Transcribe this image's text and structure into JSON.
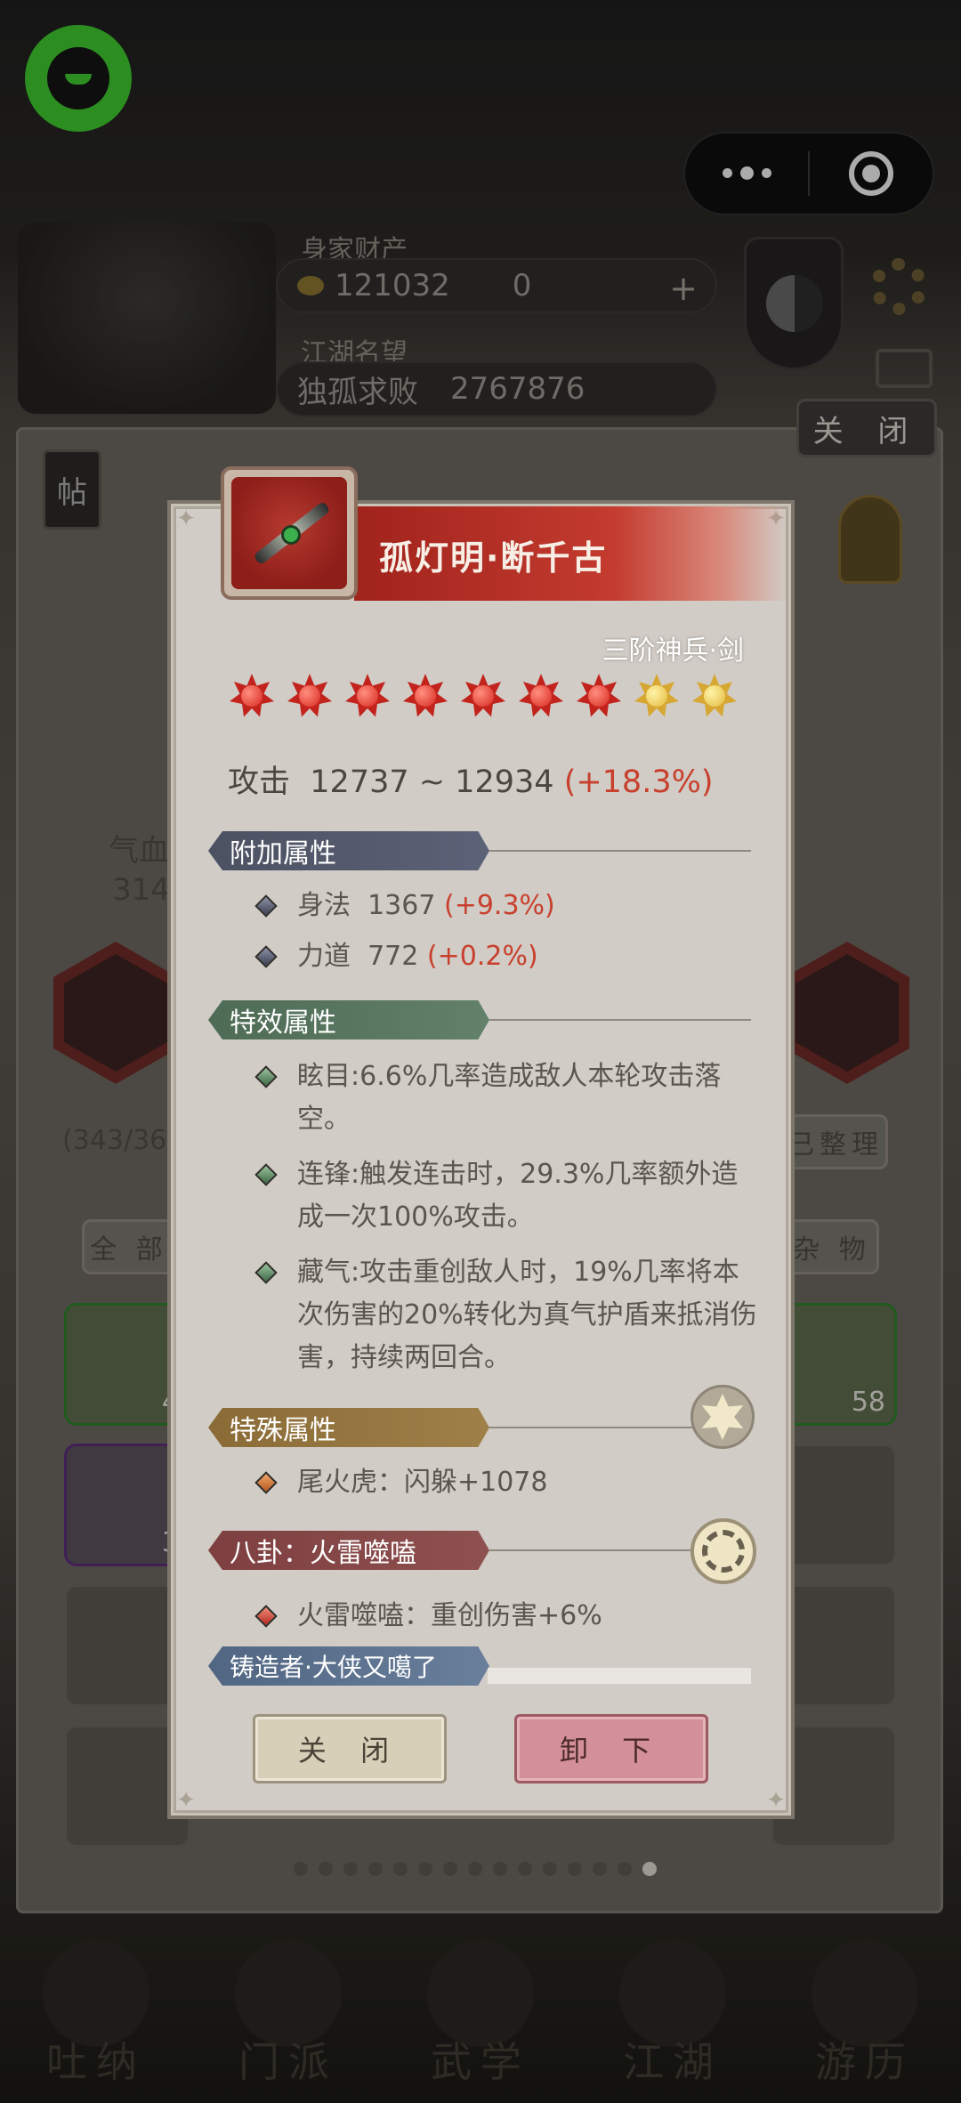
{
  "background": {
    "assets_label": "身家财产",
    "coins": "121032",
    "tickets": "0",
    "fame_label": "江湖名望",
    "fame_title": "独孤求败",
    "fame_value": "2767876",
    "close_label": "关 闭",
    "post_label": "帖",
    "hp_label": "气血",
    "hp_value": "314",
    "inventory_count": "(343/36",
    "sort_label": "已整理",
    "filter_all": "全 部",
    "filter_misc": "杂 物",
    "slot_count_1": "4",
    "slot_count_2": "58",
    "slot_count_3": "3",
    "nav": [
      "吐纳",
      "门派",
      "武学",
      "江湖",
      "游历"
    ]
  },
  "modal": {
    "title": "孤灯明·断千古",
    "subtitle": "三阶神兵·剑",
    "stars": [
      "red",
      "red",
      "red",
      "red",
      "red",
      "red",
      "red",
      "gold",
      "gold"
    ],
    "attack_label": "攻击",
    "attack_value": "12737 ~ 12934",
    "attack_bonus": "(+18.3%)",
    "extra_section": "附加属性",
    "extra": [
      {
        "label": "身法",
        "value": "1367",
        "bonus": "(+9.3%)"
      },
      {
        "label": "力道",
        "value": "772",
        "bonus": "(+0.2%)"
      }
    ],
    "effect_section": "特效属性",
    "effects": [
      "眩目:6.6%几率造成敌人本轮攻击落空。",
      "连锋:触发连击时，29.3%几率额外造成一次100%攻击。",
      "藏气:攻击重创敌人时，19%几率将本次伤害的20%转化为真气护盾来抵消伤害，持续两回合。"
    ],
    "special_section": "特殊属性",
    "special_line": "尾火虎：闪躲+1078",
    "bagua_section": "八卦：火雷噬嗑",
    "bagua_line": "火雷噬嗑：重创伤害+6%",
    "forger": "铸造者·大侠又噶了",
    "close_button": "关 闭",
    "unequip_button": "卸 下"
  },
  "colors": {
    "title_red": "#b42d24",
    "bonus_red": "#c8402d",
    "special_purple": "#9a39b8",
    "modal_bg": "#d1ccc6",
    "wechat_green": "#3ec42f"
  }
}
